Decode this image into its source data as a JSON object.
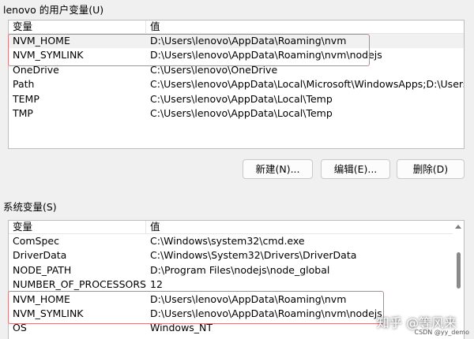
{
  "user_section": {
    "title": "lenovo 的用户变量(U)",
    "col_name": "变量",
    "col_value": "值",
    "rows": [
      {
        "name": "NVM_HOME",
        "value": "D:\\Users\\lenovo\\AppData\\Roaming\\nvm"
      },
      {
        "name": "NVM_SYMLINK",
        "value": "D:\\Users\\lenovo\\AppData\\Roaming\\nvm\\nodejs"
      },
      {
        "name": "OneDrive",
        "value": "C:\\Users\\lenovo\\OneDrive"
      },
      {
        "name": "Path",
        "value": "C:\\Users\\lenovo\\AppData\\Local\\Microsoft\\WindowsApps;D:\\Users\\..."
      },
      {
        "name": "TEMP",
        "value": "C:\\Users\\lenovo\\AppData\\Local\\Temp"
      },
      {
        "name": "TMP",
        "value": "C:\\Users\\lenovo\\AppData\\Local\\Temp"
      }
    ],
    "buttons": {
      "new": "新建(N)...",
      "edit": "编辑(E)...",
      "delete": "删除(D)"
    }
  },
  "system_section": {
    "title": "系统变量(S)",
    "col_name": "变量",
    "col_value": "值",
    "rows": [
      {
        "name": "ComSpec",
        "value": "C:\\Windows\\system32\\cmd.exe"
      },
      {
        "name": "DriverData",
        "value": "C:\\Windows\\System32\\Drivers\\DriverData"
      },
      {
        "name": "NODE_PATH",
        "value": "D:\\Program Files\\nodejs\\node_global"
      },
      {
        "name": "NUMBER_OF_PROCESSORS",
        "value": "12"
      },
      {
        "name": "NVM_HOME",
        "value": "D:\\Users\\lenovo\\AppData\\Roaming\\nvm"
      },
      {
        "name": "NVM_SYMLINK",
        "value": "D:\\Users\\lenovo\\AppData\\Roaming\\nvm\\nodejs"
      },
      {
        "name": "OS",
        "value": "Windows_NT"
      }
    ]
  },
  "watermark": {
    "text": "知乎 @等风来",
    "small": "CSDN @yy_demo"
  },
  "colors": {
    "highlight_border": "#d97a7a",
    "window_bg": "#f0f0f0"
  }
}
